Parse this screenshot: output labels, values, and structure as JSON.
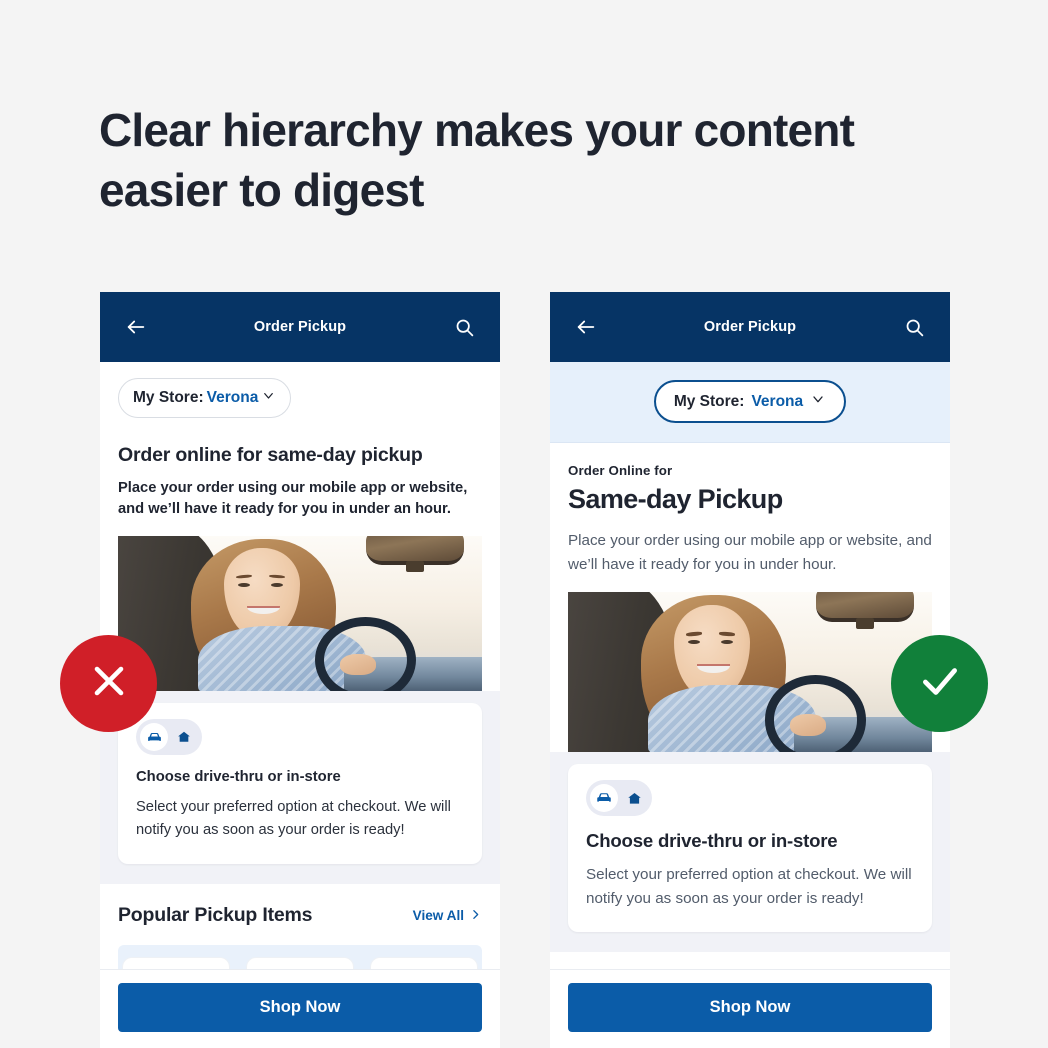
{
  "headline": "Clear hierarchy makes your content easier to digest",
  "badges": {
    "bad": {
      "icon": "close-icon",
      "color": "#d01f28"
    },
    "good": {
      "icon": "check-icon",
      "color": "#11803a"
    }
  },
  "theme": {
    "navy": "#063465",
    "blue": "#0b5ca8",
    "band_blue": "#e6f0fb",
    "page_bg": "#f4f4f4",
    "section_gray": "#f1f2f7"
  },
  "bad_example": {
    "appbar": {
      "back_icon": "back-arrow-icon",
      "title": "Order Pickup",
      "search_icon": "search-icon"
    },
    "store_chip": {
      "label": "My Store:",
      "store_name": "Verona",
      "chevron_icon": "chevron-down-icon"
    },
    "heading": "Order online for same-day pickup",
    "body": "Place your order using our mobile app or website, and we’ll have it ready for you in under an hour.",
    "photo_alt": "woman-driving-car-photo",
    "card": {
      "icons": [
        "car-icon",
        "home-icon"
      ],
      "heading": "Choose drive-thru or in-store",
      "body": "Select your preferred option at checkout. We will notify you as soon as your order is ready!"
    },
    "popular": {
      "title": "Popular Pickup Items",
      "view_all": "View All",
      "view_all_icon": "chevron-right-icon"
    },
    "cta": "Shop Now"
  },
  "good_example": {
    "appbar": {
      "back_icon": "back-arrow-icon",
      "title": "Order Pickup",
      "search_icon": "search-icon"
    },
    "store_chip": {
      "label": "My Store:",
      "store_name": "Verona",
      "chevron_icon": "chevron-down-icon"
    },
    "eyebrow": "Order Online for",
    "heading": "Same-day Pickup",
    "body": "Place your order using our mobile app or website, and we’ll have it ready for you in under hour.",
    "photo_alt": "woman-driving-car-photo",
    "card": {
      "icons": [
        "car-icon",
        "home-icon"
      ],
      "heading": "Choose drive-thru or in-store",
      "body": "Select your preferred option at checkout. We will notify you as soon as your order is ready!"
    },
    "cta": "Shop Now"
  }
}
